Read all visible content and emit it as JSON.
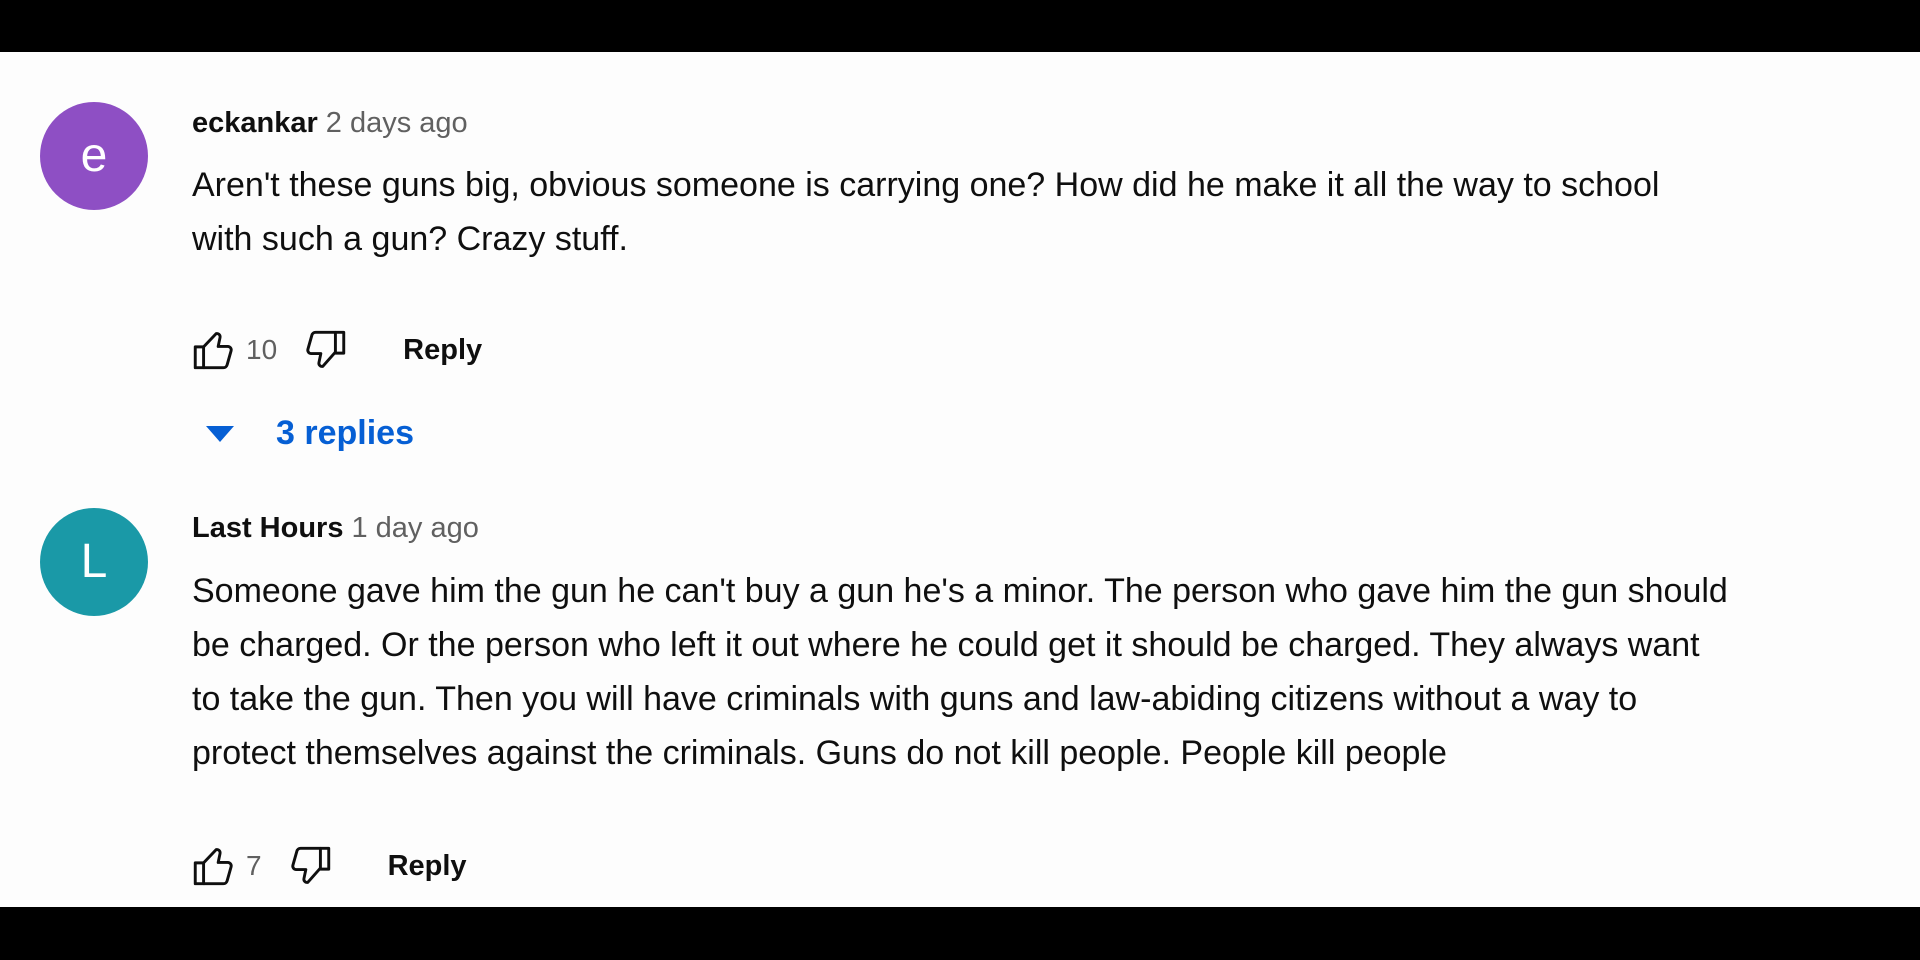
{
  "comments": [
    {
      "avatar_letter": "e",
      "avatar_color": "#8e4fc4",
      "author": "eckankar",
      "time": "2 days ago",
      "text_lines": [
        "Aren't these guns big, obvious someone is carrying one?  How did he make it all the way to school",
        "with such a gun?  Crazy stuff."
      ],
      "likes": "10",
      "reply_label": "Reply",
      "replies_label": "3 replies"
    },
    {
      "avatar_letter": "L",
      "avatar_color": "#1a99a7",
      "author": "Last Hours",
      "time": "1 day ago",
      "text_lines": [
        "Someone gave him the gun he can't buy a gun he's a minor. The person who gave him the gun should",
        "be charged. Or the person who left it out where he could get it should be charged. They always want",
        "to take the gun. Then you will have criminals with guns and law-abiding citizens without a way to",
        "protect themselves against the criminals. Guns do not kill people. People kill people"
      ],
      "likes": "7",
      "reply_label": "Reply"
    }
  ],
  "icons": {
    "like": "thumbs-up-icon",
    "dislike": "thumbs-down-icon",
    "expand": "caret-down-icon"
  },
  "colors": {
    "link_blue": "#065fd4",
    "text": "#0f0f0f",
    "secondary": "#606060"
  }
}
